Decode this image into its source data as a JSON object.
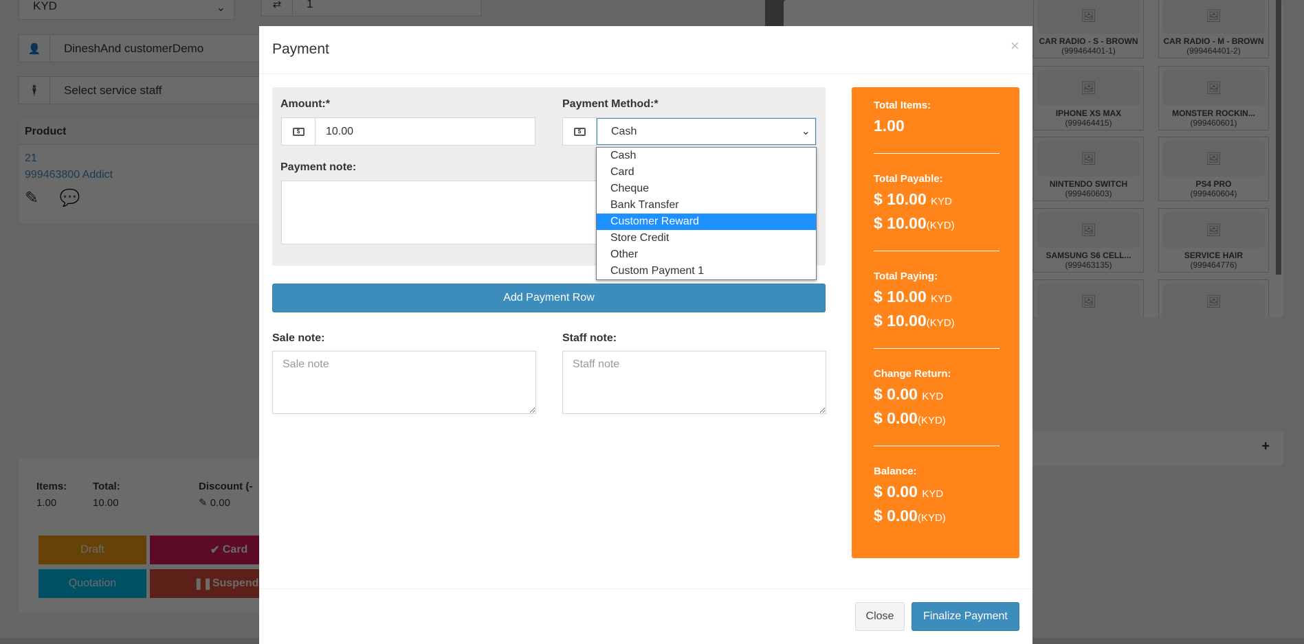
{
  "background": {
    "currency_select": "KYD",
    "customer": "DineshAnd customerDemo",
    "service_staff_placeholder": "Select service staff",
    "quantity_value": "1",
    "table_header": "Product",
    "product_line1": "21",
    "product_line2": "999463800 Addict",
    "footer": {
      "items_label": "Items:",
      "items_value": "1.00",
      "total_label": "Total:",
      "total_value": "10.00",
      "discount_label": "Discount (-",
      "discount_value": "0.00"
    },
    "buttons": {
      "draft": "Draft",
      "card": "Card",
      "quotation": "Quotation",
      "suspend": "Suspend"
    },
    "products": [
      {
        "name": "CAR RADIO - S - BROWN",
        "sku": "(999464401-1)"
      },
      {
        "name": "CAR RADIO - M - BROWN",
        "sku": "(999464401-2)"
      },
      {
        "name": "IPHONE XS MAX",
        "sku": "(999464415)"
      },
      {
        "name": "MONSTER ROCKIN...",
        "sku": "(999460601)"
      },
      {
        "name": "NINTENDO SWITCH",
        "sku": "(999460603)"
      },
      {
        "name": "PS4 PRO",
        "sku": "(999460604)"
      },
      {
        "name": "SAMSUNG S6 CELL...",
        "sku": "(999463135)"
      },
      {
        "name": "SERVICE HAIR",
        "sku": "(999464776)"
      }
    ]
  },
  "modal": {
    "title": "Payment",
    "close_x": "×",
    "amount_label": "Amount:*",
    "amount_value": "10.00",
    "method_label": "Payment Method:*",
    "method_value": "Cash",
    "method_options": [
      "Cash",
      "Card",
      "Cheque",
      "Bank Transfer",
      "Customer Reward",
      "Store Credit",
      "Other",
      "Custom Payment 1"
    ],
    "highlighted_option": "Customer Reward",
    "payment_note_label": "Payment note:",
    "add_row": "Add Payment Row",
    "sale_note_label": "Sale note:",
    "sale_note_placeholder": "Sale note",
    "staff_note_label": "Staff note:",
    "staff_note_placeholder": "Staff note",
    "close": "Close",
    "finalize": "Finalize Payment"
  },
  "summary": {
    "total_items_label": "Total Items:",
    "total_items": "1.00",
    "total_payable_label": "Total Payable:",
    "total_payable": "$ 10.00",
    "total_payable_cur": "KYD",
    "total_payable2": "$ 10.00",
    "total_payable2_cur": "(KYD)",
    "total_paying_label": "Total Paying:",
    "total_paying": "$ 10.00",
    "total_paying_cur": "KYD",
    "total_paying2": "$ 10.00",
    "total_paying2_cur": "(KYD)",
    "change_label": "Change Return:",
    "change": "$ 0.00",
    "change_cur": "KYD",
    "change2": "$ 0.00",
    "change2_cur": "(KYD)",
    "balance_label": "Balance:",
    "balance": "$ 0.00",
    "balance_cur": "KYD",
    "balance2": "$ 0.00",
    "balance2_cur": "(KYD)"
  },
  "colors": {
    "summary": "#ff851b",
    "primary": "#3c8dbc",
    "highlight": "#1e90ff"
  }
}
